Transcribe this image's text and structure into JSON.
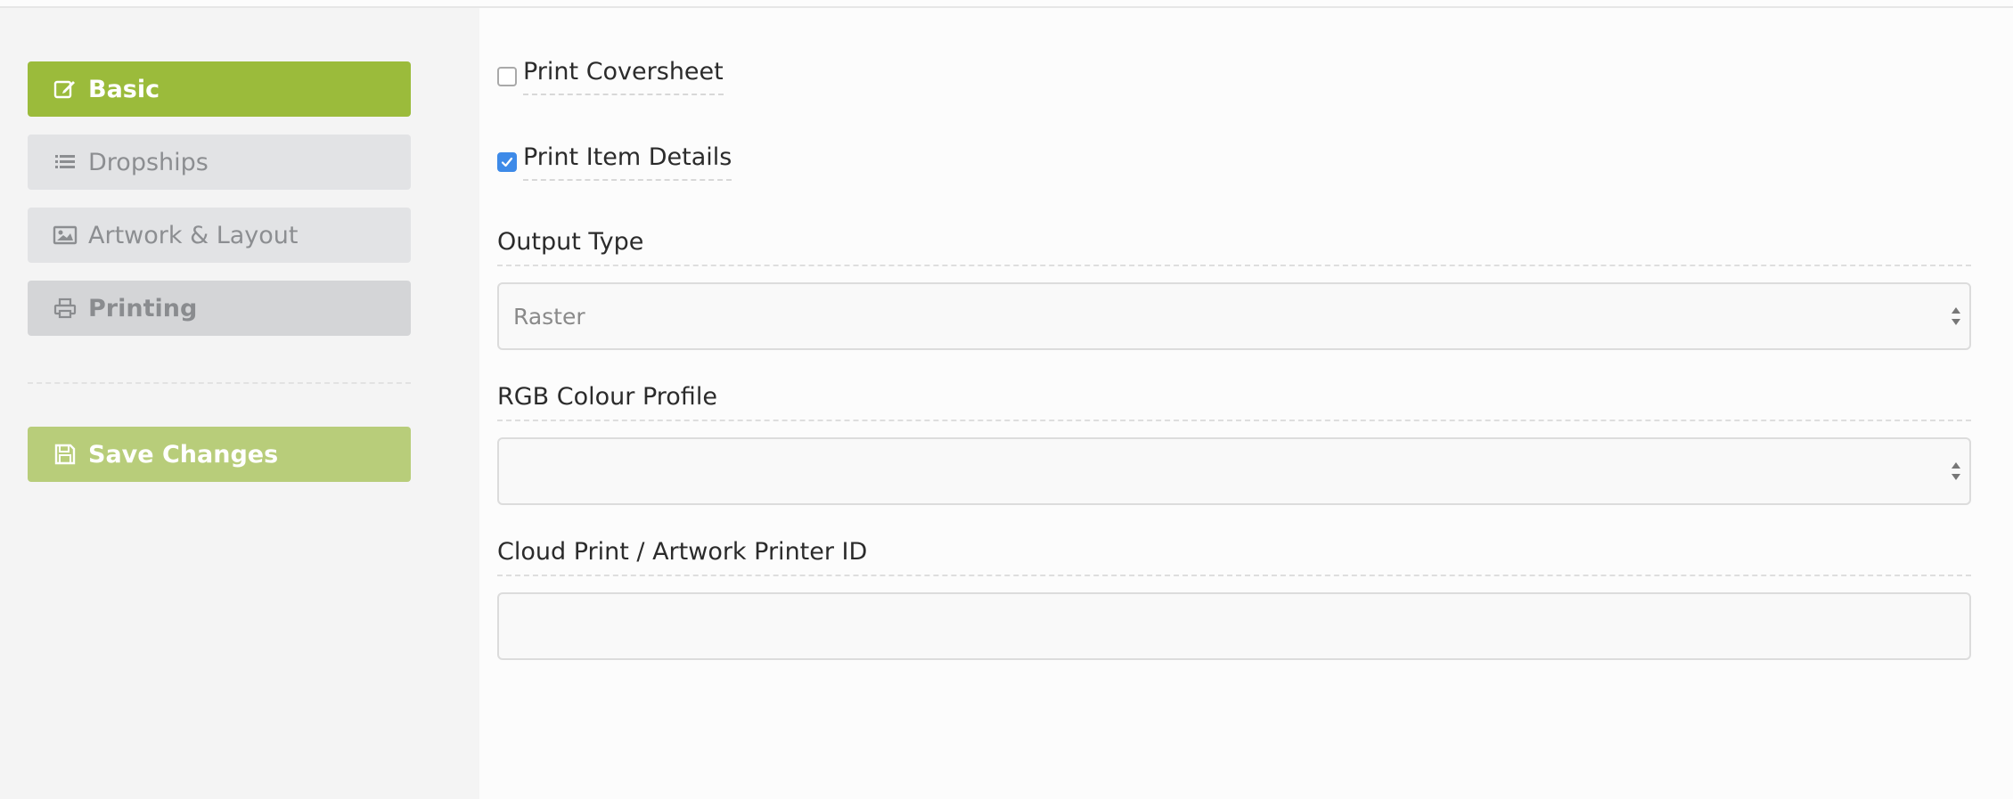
{
  "sidebar": {
    "nav": [
      {
        "label": "Basic",
        "icon": "edit-icon"
      },
      {
        "label": "Dropships",
        "icon": "list-icon"
      },
      {
        "label": "Artwork & Layout",
        "icon": "image-icon"
      },
      {
        "label": "Printing",
        "icon": "printer-icon"
      }
    ],
    "save": {
      "label": "Save Changes",
      "icon": "floppy-disk-icon"
    }
  },
  "form": {
    "print_coversheet": {
      "label": "Print Coversheet",
      "checked": false
    },
    "print_item_details": {
      "label": "Print Item Details",
      "checked": true
    },
    "output_type": {
      "label": "Output Type",
      "value": "Raster"
    },
    "rgb_profile": {
      "label": "RGB Colour Profile",
      "value": ""
    },
    "cloud_print": {
      "label": "Cloud Print / Artwork Printer ID",
      "value": ""
    }
  },
  "colors": {
    "active_green": "#9bbb3b",
    "save_green": "#b8cd7a",
    "inactive_gray": "#e2e3e5",
    "checkbox_blue": "#3d8ae8"
  }
}
